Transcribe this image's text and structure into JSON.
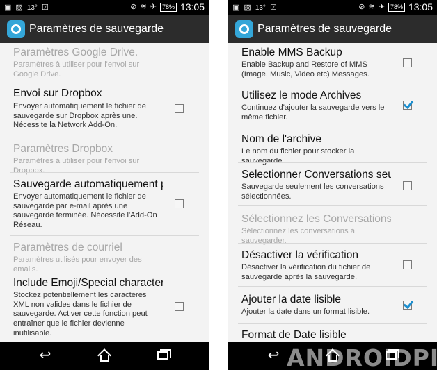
{
  "status_bar": {
    "temperature": "13°",
    "battery": "78%",
    "clock": "13:05"
  },
  "app": {
    "title": "Paramètres de sauvegarde",
    "icon": "backup-app-icon"
  },
  "left_screen": {
    "rows": [
      {
        "title": "Paramètres Google Drive.",
        "subtitle": "Paramètres à utiliser pour l'envoi sur Google Drive.",
        "enabled": false,
        "checkbox": null
      },
      {
        "title": "Envoi sur Dropbox",
        "subtitle": "Envoyer automatiquement le fichier de sauvegarde sur Dropbox après une. Nécessite la Network Add-On.",
        "enabled": true,
        "checkbox": false
      },
      {
        "title": "Paramètres Dropbox",
        "subtitle": "Paramètres à utiliser pour l'envoi sur Dropbox.",
        "enabled": false,
        "checkbox": null
      },
      {
        "title": "Sauvegarde automatiquement p",
        "subtitle": "Envoyer automatiquement le fichier de sauvegarde par e-mail après une sauvegarde terminée. Nécessite l'Add-On Réseau.",
        "enabled": true,
        "checkbox": false
      },
      {
        "title": "Paramètres de courriel",
        "subtitle": "Paramètres utilisés pour envoyer des emails.",
        "enabled": false,
        "checkbox": null
      },
      {
        "title": "Include Emoji/Special character",
        "subtitle": "Stockez potentiellement les caractères XML non valides dans le fichier de sauvegarde. Activer cette fonction peut entraîner que le fichier devienne inutilisable.",
        "enabled": true,
        "checkbox": false
      }
    ]
  },
  "right_screen": {
    "rows": [
      {
        "title": "Enable MMS Backup",
        "subtitle": "Enable Backup and Restore of MMS (Image, Music, Video etc) Messages.",
        "enabled": true,
        "checkbox": false
      },
      {
        "title": "Utilisez le mode Archives",
        "subtitle": "Continuez d'ajouter la sauvegarde vers le même fichier.",
        "enabled": true,
        "checkbox": true
      },
      {
        "title": "Nom de l'archive",
        "subtitle": "Le nom du fichier pour stocker la sauvegarde.",
        "enabled": true,
        "checkbox": null
      },
      {
        "title": "Selectionner Conversations seu",
        "subtitle": "Sauvegarde seulement les conversations sélectionnées.",
        "enabled": true,
        "checkbox": false
      },
      {
        "title": "Sélectionnez les Conversations",
        "subtitle": "Sélectionnez les conversations à sauvegarder.",
        "enabled": false,
        "checkbox": null
      },
      {
        "title": "Désactiver la vérification",
        "subtitle": "Désactiver la vérification du fichier de sauvegarde après la sauvegarde.",
        "enabled": true,
        "checkbox": false
      },
      {
        "title": "Ajouter la date lisible",
        "subtitle": "Ajouter la date dans un format lisible.",
        "enabled": true,
        "checkbox": true
      },
      {
        "title": "Format de Date lisible",
        "subtitle": "",
        "enabled": true,
        "checkbox": null
      }
    ]
  },
  "watermark": "ANDROIDPIT",
  "colors": {
    "action_bar": "#2c2c2c",
    "accent": "#1d8fcf",
    "app_icon": "#34a6d8",
    "disabled_text": "#a7a7a7"
  }
}
